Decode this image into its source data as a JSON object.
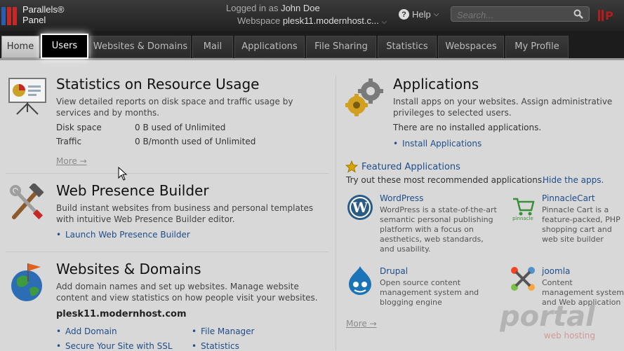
{
  "header": {
    "logo_line1": "Parallels®",
    "logo_line2": "Panel",
    "logged_in_label": "Logged in as",
    "user_name": "John Doe",
    "webspace_label": "Webspace",
    "webspace_value": "plesk11.modernhost.c...",
    "help_label": "Help",
    "search_placeholder": "Search..."
  },
  "nav": {
    "tabs": [
      {
        "label": "Home"
      },
      {
        "label": "Users"
      },
      {
        "label": "Websites & Domains"
      },
      {
        "label": "Mail"
      },
      {
        "label": "Applications"
      },
      {
        "label": "File Sharing"
      },
      {
        "label": "Statistics"
      },
      {
        "label": "Webspaces"
      },
      {
        "label": "My Profile"
      }
    ]
  },
  "stats": {
    "title": "Statistics on Resource Usage",
    "desc": "View detailed reports on disk space and traffic usage by services and by months.",
    "rows": [
      {
        "label": "Disk space",
        "value": "0 B used of Unlimited"
      },
      {
        "label": "Traffic",
        "value": "0 B/month used of Unlimited"
      }
    ],
    "more": "More →"
  },
  "wpb": {
    "title": "Web Presence Builder",
    "desc": "Build instant websites from business and personal templates with intuitive Web Presence Builder editor.",
    "link": "Launch Web Presence Builder"
  },
  "wd": {
    "title": "Websites & Domains",
    "desc": "Add domain names and set up websites. Manage website content and view statistics on how people visit your websites.",
    "domain": "plesk11.modernhost.com",
    "links": [
      "Add Domain",
      "File Manager",
      "Secure Your Site with SSL",
      "Statistics"
    ]
  },
  "apps": {
    "title": "Applications",
    "desc": "Install apps on your websites. Assign administrative privileges to selected users.",
    "none": "There are no installed applications.",
    "install": "Install Applications",
    "featured_title": "Featured Applications",
    "featured_desc": "Try out these most recommended applications.",
    "hide": "Hide the apps.",
    "items": [
      {
        "name": "WordPress",
        "desc": "WordPress is a state-of-the-art semantic personal publishing platform with a focus on aesthetics, web standards, and usability."
      },
      {
        "name": "PinnacleCart",
        "desc": "Pinnacle Cart is a feature-packed, PHP shopping cart and web site builder application"
      },
      {
        "name": "Drupal",
        "desc": "Open source content management system and blogging engine"
      },
      {
        "name": "joomla",
        "desc": "Content management system and Web application framework"
      }
    ],
    "more": "More →"
  },
  "watermark": {
    "line1": "portal",
    "line2": "web hosting"
  },
  "colors": {
    "link": "#1e4d8a",
    "nav_bg": "#1c1c1c",
    "content_bg": "#d8d8d8"
  }
}
